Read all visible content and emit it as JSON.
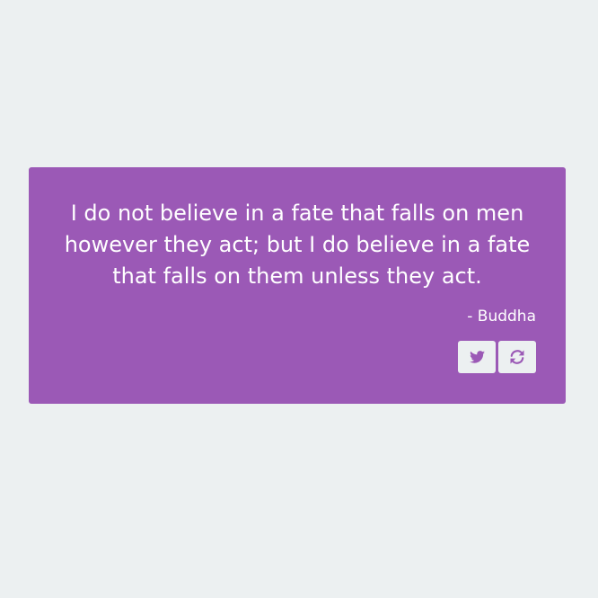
{
  "quote": {
    "text": "I do not believe in a fate that falls on men however they act; but I do believe in a fate that falls on them unless they act.",
    "author": "- Buddha"
  },
  "actions": {
    "tweet_icon": "twitter-icon",
    "new_quote_icon": "refresh-icon"
  },
  "colors": {
    "background": "#ecf0f1",
    "card": "#9b59b6",
    "text": "#ffffff"
  }
}
